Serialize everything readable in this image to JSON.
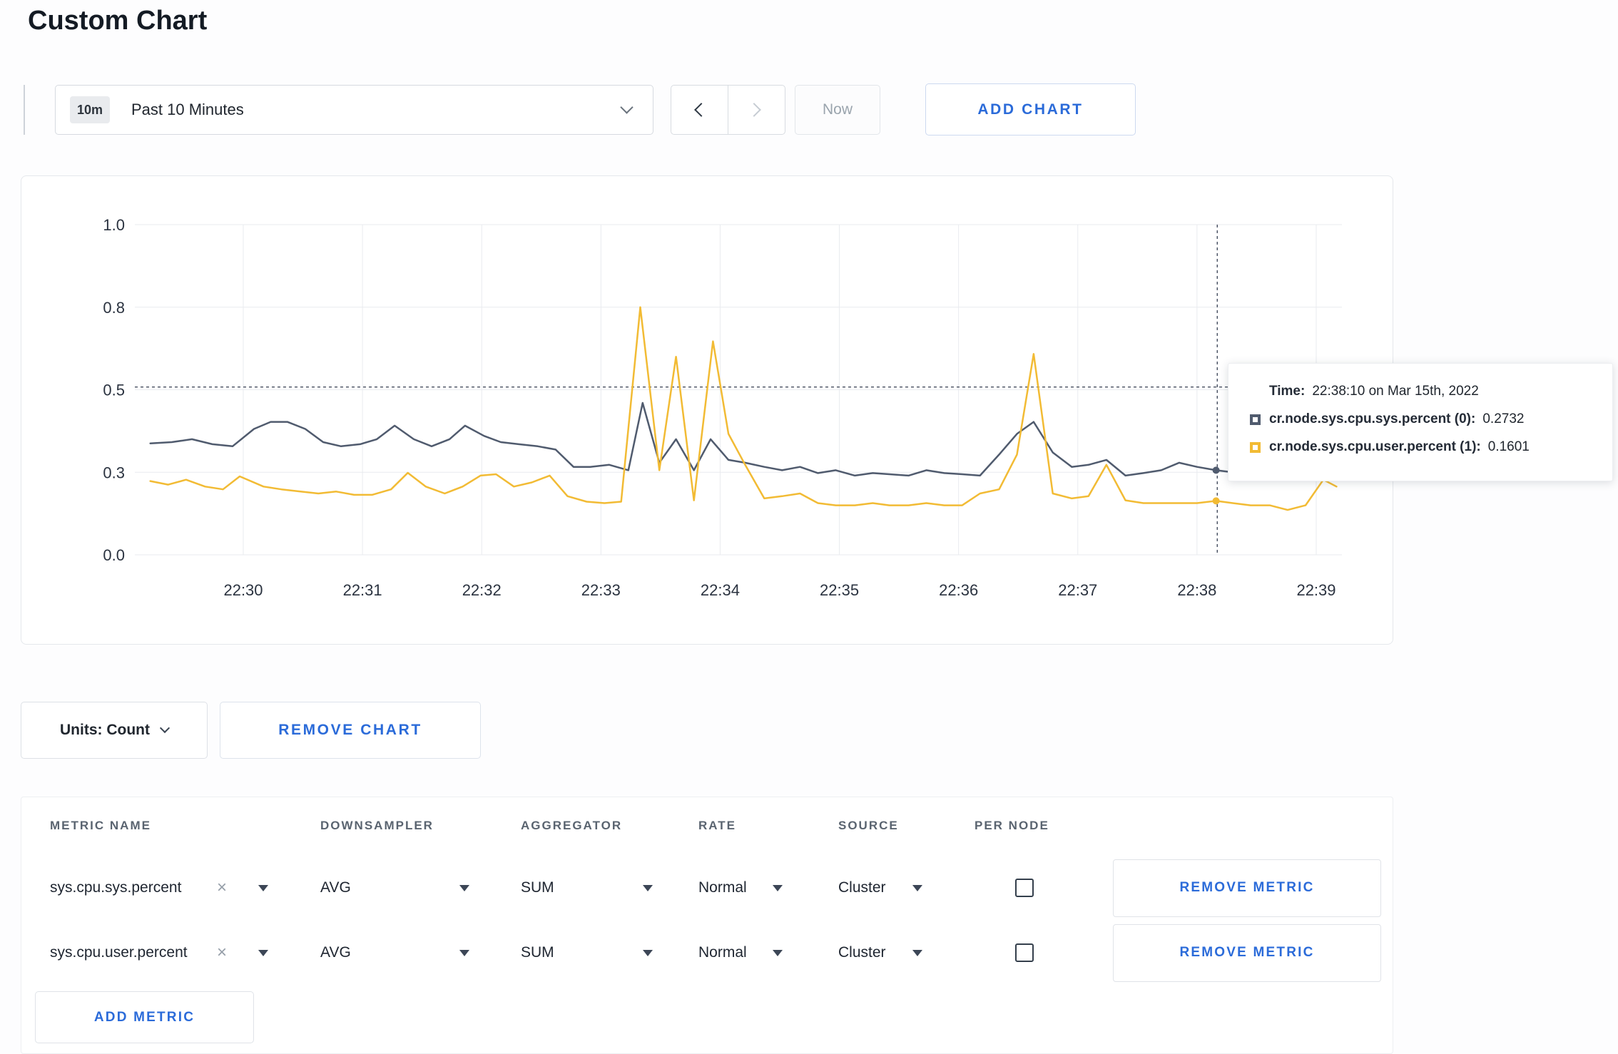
{
  "page": {
    "title": "Custom Chart"
  },
  "theme": {
    "accent_blue": "#2b6bd9"
  },
  "icons": {
    "clear_x": "×"
  },
  "toolbar": {
    "time_range": {
      "badge": "10m",
      "label": "Past 10 Minutes"
    },
    "now_label": "Now",
    "add_chart_label": "ADD CHART"
  },
  "chart": {
    "tooltip": {
      "time_label": "Time:",
      "time_value": "22:38:10 on Mar 15th, 2022",
      "series": [
        {
          "label": "cr.node.sys.cpu.sys.percent (0):",
          "value": "0.2732"
        },
        {
          "label": "cr.node.sys.cpu.user.percent (1):",
          "value": "0.1601"
        }
      ]
    }
  },
  "chart_data": {
    "type": "line",
    "title": "",
    "xlabel": "",
    "ylabel": "",
    "grid": true,
    "y_ticks": [
      0.0,
      0.3,
      0.5,
      0.8,
      1.0
    ],
    "y_tick_labels": [
      "0.0",
      "0.3",
      "0.5",
      "0.8",
      "1.0"
    ],
    "x_ticks": [
      30,
      31,
      32,
      33,
      34,
      35,
      36,
      37,
      38,
      39
    ],
    "x_tick_labels": [
      "22:30",
      "22:31",
      "22:32",
      "22:33",
      "22:34",
      "22:35",
      "22:36",
      "22:37",
      "22:38",
      "22:39"
    ],
    "crosshair": {
      "x_minutes": 38.17,
      "y_value": 0.51
    },
    "series": [
      {
        "name": "cr.node.sys.cpu.sys.percent",
        "color": "#505b6e",
        "points": [
          [
            29.22,
            0.37
          ],
          [
            29.4,
            0.373
          ],
          [
            29.57,
            0.38
          ],
          [
            29.74,
            0.368
          ],
          [
            29.91,
            0.363
          ],
          [
            30.09,
            0.405
          ],
          [
            30.23,
            0.422
          ],
          [
            30.37,
            0.422
          ],
          [
            30.52,
            0.405
          ],
          [
            30.67,
            0.373
          ],
          [
            30.82,
            0.363
          ],
          [
            30.98,
            0.368
          ],
          [
            31.12,
            0.38
          ],
          [
            31.27,
            0.413
          ],
          [
            31.43,
            0.38
          ],
          [
            31.58,
            0.363
          ],
          [
            31.73,
            0.38
          ],
          [
            31.86,
            0.413
          ],
          [
            32.02,
            0.388
          ],
          [
            32.16,
            0.373
          ],
          [
            32.31,
            0.368
          ],
          [
            32.47,
            0.363
          ],
          [
            32.62,
            0.355
          ],
          [
            32.77,
            0.313
          ],
          [
            32.91,
            0.313
          ],
          [
            33.07,
            0.318
          ],
          [
            33.23,
            0.305
          ],
          [
            33.35,
            0.468
          ],
          [
            33.49,
            0.323
          ],
          [
            33.63,
            0.38
          ],
          [
            33.78,
            0.305
          ],
          [
            33.92,
            0.38
          ],
          [
            34.07,
            0.33
          ],
          [
            34.21,
            0.323
          ],
          [
            34.37,
            0.313
          ],
          [
            34.52,
            0.305
          ],
          [
            34.67,
            0.313
          ],
          [
            34.82,
            0.297
          ],
          [
            34.97,
            0.305
          ],
          [
            35.13,
            0.288
          ],
          [
            35.28,
            0.297
          ],
          [
            35.42,
            0.293
          ],
          [
            35.58,
            0.288
          ],
          [
            35.73,
            0.305
          ],
          [
            35.88,
            0.297
          ],
          [
            36.03,
            0.293
          ],
          [
            36.18,
            0.288
          ],
          [
            36.34,
            0.343
          ],
          [
            36.49,
            0.393
          ],
          [
            36.63,
            0.422
          ],
          [
            36.79,
            0.348
          ],
          [
            36.95,
            0.313
          ],
          [
            37.09,
            0.318
          ],
          [
            37.24,
            0.33
          ],
          [
            37.4,
            0.288
          ],
          [
            37.55,
            0.297
          ],
          [
            37.7,
            0.305
          ],
          [
            37.85,
            0.323
          ],
          [
            38.0,
            0.313
          ],
          [
            38.16,
            0.305
          ],
          [
            38.3,
            0.3
          ],
          [
            38.45,
            0.31
          ],
          [
            38.61,
            0.3
          ],
          [
            38.76,
            0.308
          ],
          [
            38.91,
            0.298
          ],
          [
            39.06,
            0.31
          ],
          [
            39.17,
            0.3
          ]
        ]
      },
      {
        "name": "cr.node.sys.cpu.user.percent",
        "color": "#f2bb34",
        "points": [
          [
            29.22,
            0.268
          ],
          [
            29.37,
            0.255
          ],
          [
            29.52,
            0.273
          ],
          [
            29.68,
            0.248
          ],
          [
            29.83,
            0.238
          ],
          [
            29.97,
            0.285
          ],
          [
            30.17,
            0.248
          ],
          [
            30.32,
            0.238
          ],
          [
            30.48,
            0.23
          ],
          [
            30.63,
            0.223
          ],
          [
            30.78,
            0.23
          ],
          [
            30.93,
            0.218
          ],
          [
            31.08,
            0.218
          ],
          [
            31.24,
            0.238
          ],
          [
            31.38,
            0.298
          ],
          [
            31.53,
            0.248
          ],
          [
            31.69,
            0.223
          ],
          [
            31.84,
            0.248
          ],
          [
            31.99,
            0.288
          ],
          [
            32.12,
            0.293
          ],
          [
            32.27,
            0.248
          ],
          [
            32.42,
            0.263
          ],
          [
            32.57,
            0.288
          ],
          [
            32.72,
            0.213
          ],
          [
            32.88,
            0.193
          ],
          [
            33.03,
            0.188
          ],
          [
            33.17,
            0.193
          ],
          [
            33.33,
            0.8
          ],
          [
            33.49,
            0.305
          ],
          [
            33.63,
            0.62
          ],
          [
            33.78,
            0.198
          ],
          [
            33.94,
            0.676
          ],
          [
            34.07,
            0.393
          ],
          [
            34.21,
            0.318
          ],
          [
            34.37,
            0.205
          ],
          [
            34.52,
            0.213
          ],
          [
            34.67,
            0.223
          ],
          [
            34.82,
            0.188
          ],
          [
            34.97,
            0.18
          ],
          [
            35.13,
            0.18
          ],
          [
            35.28,
            0.188
          ],
          [
            35.42,
            0.18
          ],
          [
            35.58,
            0.18
          ],
          [
            35.73,
            0.188
          ],
          [
            35.88,
            0.18
          ],
          [
            36.03,
            0.18
          ],
          [
            36.18,
            0.223
          ],
          [
            36.34,
            0.238
          ],
          [
            36.49,
            0.343
          ],
          [
            36.63,
            0.63
          ],
          [
            36.79,
            0.223
          ],
          [
            36.95,
            0.205
          ],
          [
            37.09,
            0.213
          ],
          [
            37.24,
            0.318
          ],
          [
            37.4,
            0.198
          ],
          [
            37.55,
            0.188
          ],
          [
            37.7,
            0.188
          ],
          [
            37.85,
            0.188
          ],
          [
            38.0,
            0.188
          ],
          [
            38.16,
            0.196
          ],
          [
            38.3,
            0.188
          ],
          [
            38.45,
            0.18
          ],
          [
            38.61,
            0.18
          ],
          [
            38.76,
            0.163
          ],
          [
            38.91,
            0.18
          ],
          [
            39.06,
            0.273
          ],
          [
            39.17,
            0.248
          ]
        ]
      }
    ]
  },
  "chart_controls": {
    "units_label": "Units: Count",
    "remove_chart_label": "REMOVE CHART"
  },
  "metrics_table": {
    "headers": [
      "METRIC NAME",
      "DOWNSAMPLER",
      "AGGREGATOR",
      "RATE",
      "SOURCE",
      "PER NODE"
    ],
    "rows": [
      {
        "metric": "sys.cpu.sys.percent",
        "downsampler": "AVG",
        "aggregator": "SUM",
        "rate": "Normal",
        "source": "Cluster",
        "per_node_checked": false,
        "remove_label": "REMOVE METRIC"
      },
      {
        "metric": "sys.cpu.user.percent",
        "downsampler": "AVG",
        "aggregator": "SUM",
        "rate": "Normal",
        "source": "Cluster",
        "per_node_checked": false,
        "remove_label": "REMOVE METRIC"
      }
    ],
    "add_metric_label": "ADD METRIC"
  }
}
